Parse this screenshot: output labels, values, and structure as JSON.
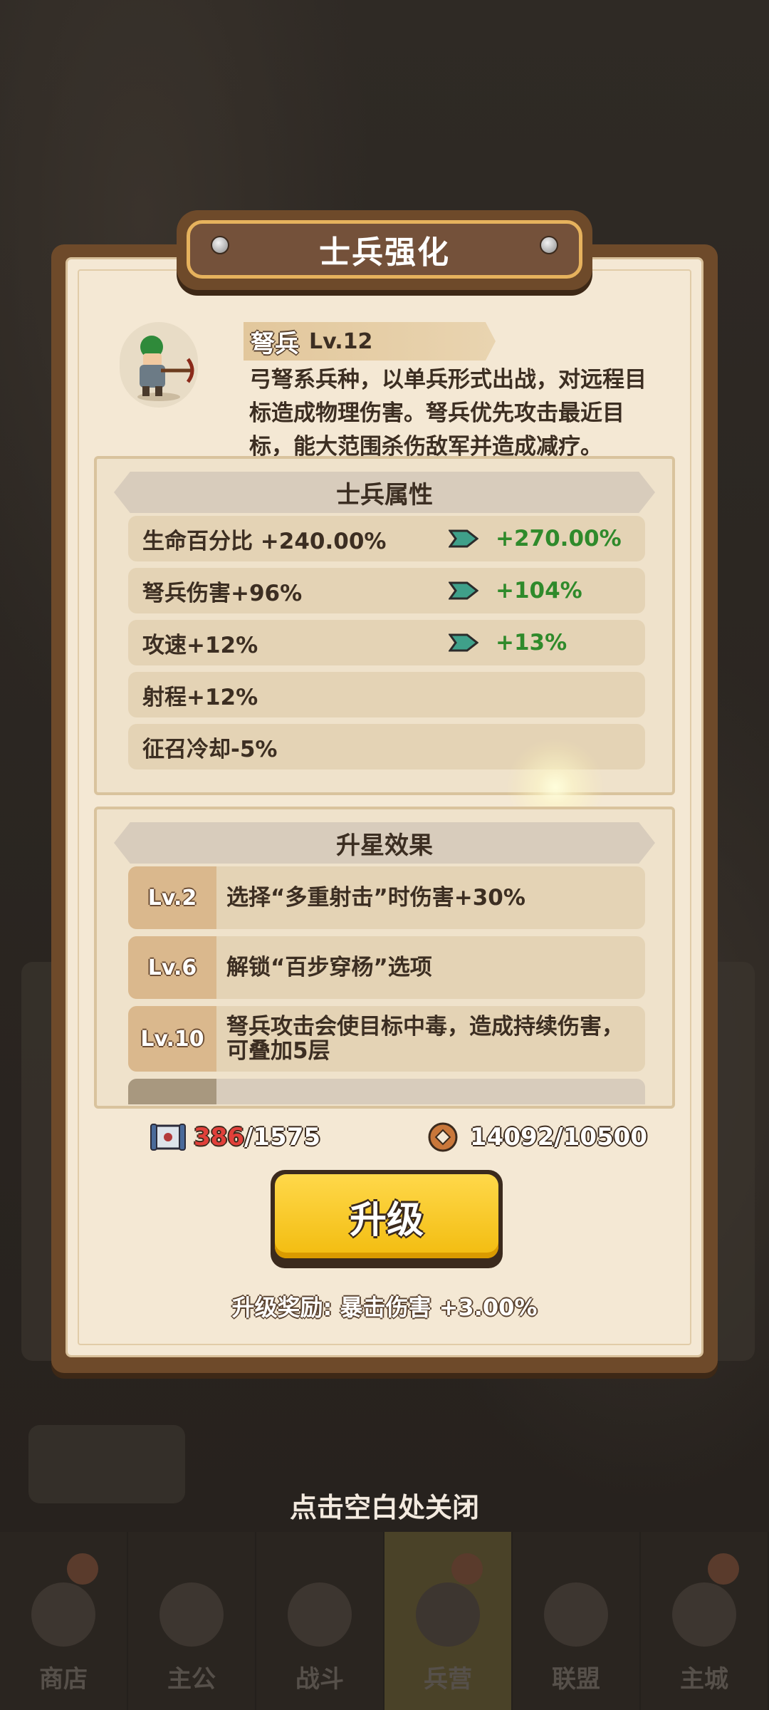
{
  "dialog": {
    "title": "士兵强化",
    "close_hint": "点击空白处关闭"
  },
  "unit": {
    "name": "弩兵",
    "level": "Lv.12",
    "description": "弓弩系兵种，以单兵形式出战，对远程目标造成物理伤害。弩兵优先攻击最近目标，能大范围杀伤敌军并造成减疗。"
  },
  "attributes": {
    "title": "士兵属性",
    "rows": [
      {
        "current": "生命百分比 +240.00%",
        "next": "+270.00%"
      },
      {
        "current": "弩兵伤害+96%",
        "next": "+104%"
      },
      {
        "current": "攻速+12%",
        "next": "+13%"
      },
      {
        "current": "射程+12%",
        "next": ""
      },
      {
        "current": "征召冷却-5%",
        "next": ""
      }
    ]
  },
  "star_effects": {
    "title": "升星效果",
    "rows": [
      {
        "level": "Lv.2",
        "text": "选择“多重射击”时伤害+30%"
      },
      {
        "level": "Lv.6",
        "text": "解锁“百步穿杨”选项"
      },
      {
        "level": "Lv.10",
        "text": "弩兵攻击会使目标中毒，造成持续伤害，可叠加5层"
      }
    ]
  },
  "costs": {
    "scroll_have": "386",
    "scroll_need": "/1575",
    "coin": "14092/10500"
  },
  "upgrade": {
    "label": "升级",
    "reward": "升级奖励: 暴击伤害 +3.00%"
  },
  "bottom_nav": [
    "商店",
    "主公",
    "战斗",
    "兵营",
    "联盟",
    "主城"
  ],
  "colors": {
    "panel_border": "#6e4a2a",
    "panel_bg": "#f4e8d4",
    "upgrade_button": "#ffd84a",
    "bonus_green": "#2f8a2b",
    "insufficient_red": "#e1403a"
  }
}
